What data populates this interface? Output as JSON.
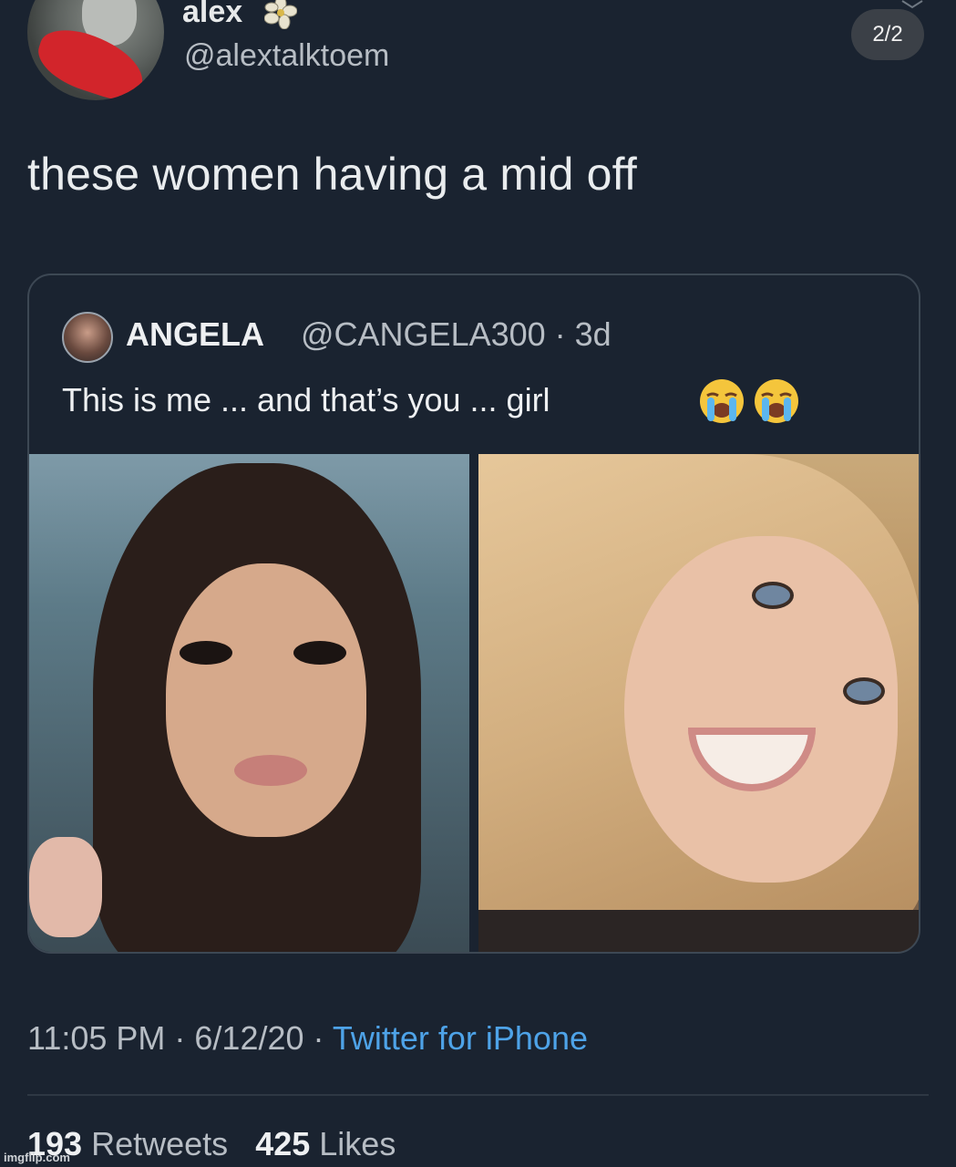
{
  "author": {
    "display_name": "alex",
    "handle": "@alextalktoem"
  },
  "pager": "2/2",
  "tweet": {
    "text": "these women having a mid off"
  },
  "quoted_tweet": {
    "name": "ANGELA",
    "handle": "@CANGELA300 · 3d",
    "text": "This is me ... and that’s you ... girl",
    "emoji_icons": [
      "loudly-crying-face-icon",
      "loudly-crying-face-icon"
    ]
  },
  "meta": {
    "time_date": "11:05 PM · 6/12/20 · ",
    "source": "Twitter for iPhone",
    "source_color": "#4ea3e8"
  },
  "stats": {
    "retweets_count": "193",
    "retweets_label": "Retweets",
    "likes_count": "425",
    "likes_label": "Likes"
  },
  "watermark": "imgflip.com"
}
